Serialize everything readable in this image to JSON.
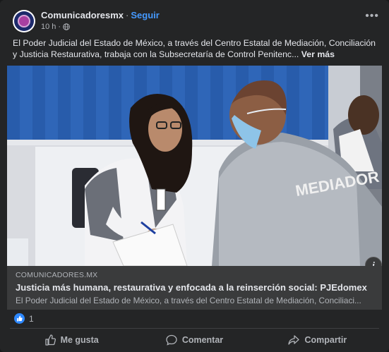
{
  "post": {
    "author": "Comunicadoresmx",
    "separator": "·",
    "follow_label": "Seguir",
    "time": "10 h",
    "time_separator": "·",
    "text": "El Poder Judicial del Estado de México, a través del Centro Estatal de Mediación, Conciliación y Justicia Restaurativa, trabaja con la Subsecretaría de Control Penitenc...",
    "see_more": "Ver más"
  },
  "photo": {
    "vest_text": "MEDIADOR",
    "info_badge": "i"
  },
  "link": {
    "domain": "COMUNICADORES.MX",
    "title": "Justicia más humana, restaurativa y enfocada a la reinserción social: PJEdomex",
    "description": "El Poder Judicial del Estado de México, a través del Centro Estatal de Mediación, Conciliaci..."
  },
  "reactions": {
    "count": "1"
  },
  "actions": {
    "like": "Me gusta",
    "comment": "Comentar",
    "share": "Compartir"
  },
  "colors": {
    "background": "#242526",
    "accent": "#4599ff",
    "like_blue": "#2d88ff",
    "curtain_blue": "#2f66b8"
  },
  "icons": [
    "more-options-icon",
    "globe-icon",
    "info-icon",
    "like-reaction-icon",
    "thumbs-up-icon",
    "comment-icon",
    "share-icon"
  ]
}
